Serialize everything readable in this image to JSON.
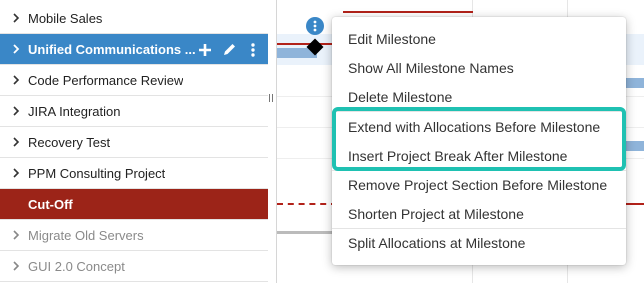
{
  "projects": {
    "mobile_sales": "Mobile Sales",
    "unified_communications": "Unified Communications ...",
    "code_performance_review": "Code Performance Review",
    "jira_integration": "JIRA Integration",
    "recovery_test": "Recovery Test",
    "ppm_consulting_project": "PPM Consulting Project",
    "cut_off": "Cut-Off",
    "migrate_old_servers": "Migrate Old Servers",
    "gui_concept": "GUI 2.0 Concept"
  },
  "context_menu": {
    "edit_milestone": "Edit Milestone",
    "show_all_milestone_names": "Show All Milestone Names",
    "delete_milestone": "Delete Milestone",
    "extend_allocations_before": "Extend with Allocations Before Milestone",
    "insert_project_break_after": "Insert Project Break After Milestone",
    "remove_section_before": "Remove Project Section Before Milestone",
    "shorten_project": "Shorten Project at Milestone",
    "split_allocations": "Split Allocations at Milestone"
  },
  "colors": {
    "selected_row": "#3a87c7",
    "cutoff_row": "#9c2418",
    "highlight_outline": "#1fc1b2",
    "allocation_bar": "#8fb4da"
  },
  "icons": {
    "expand": "chevron-right-icon",
    "add": "plus-icon",
    "edit": "pencil-icon",
    "more": "vertical-dots-icon",
    "milestone": "diamond-icon"
  }
}
